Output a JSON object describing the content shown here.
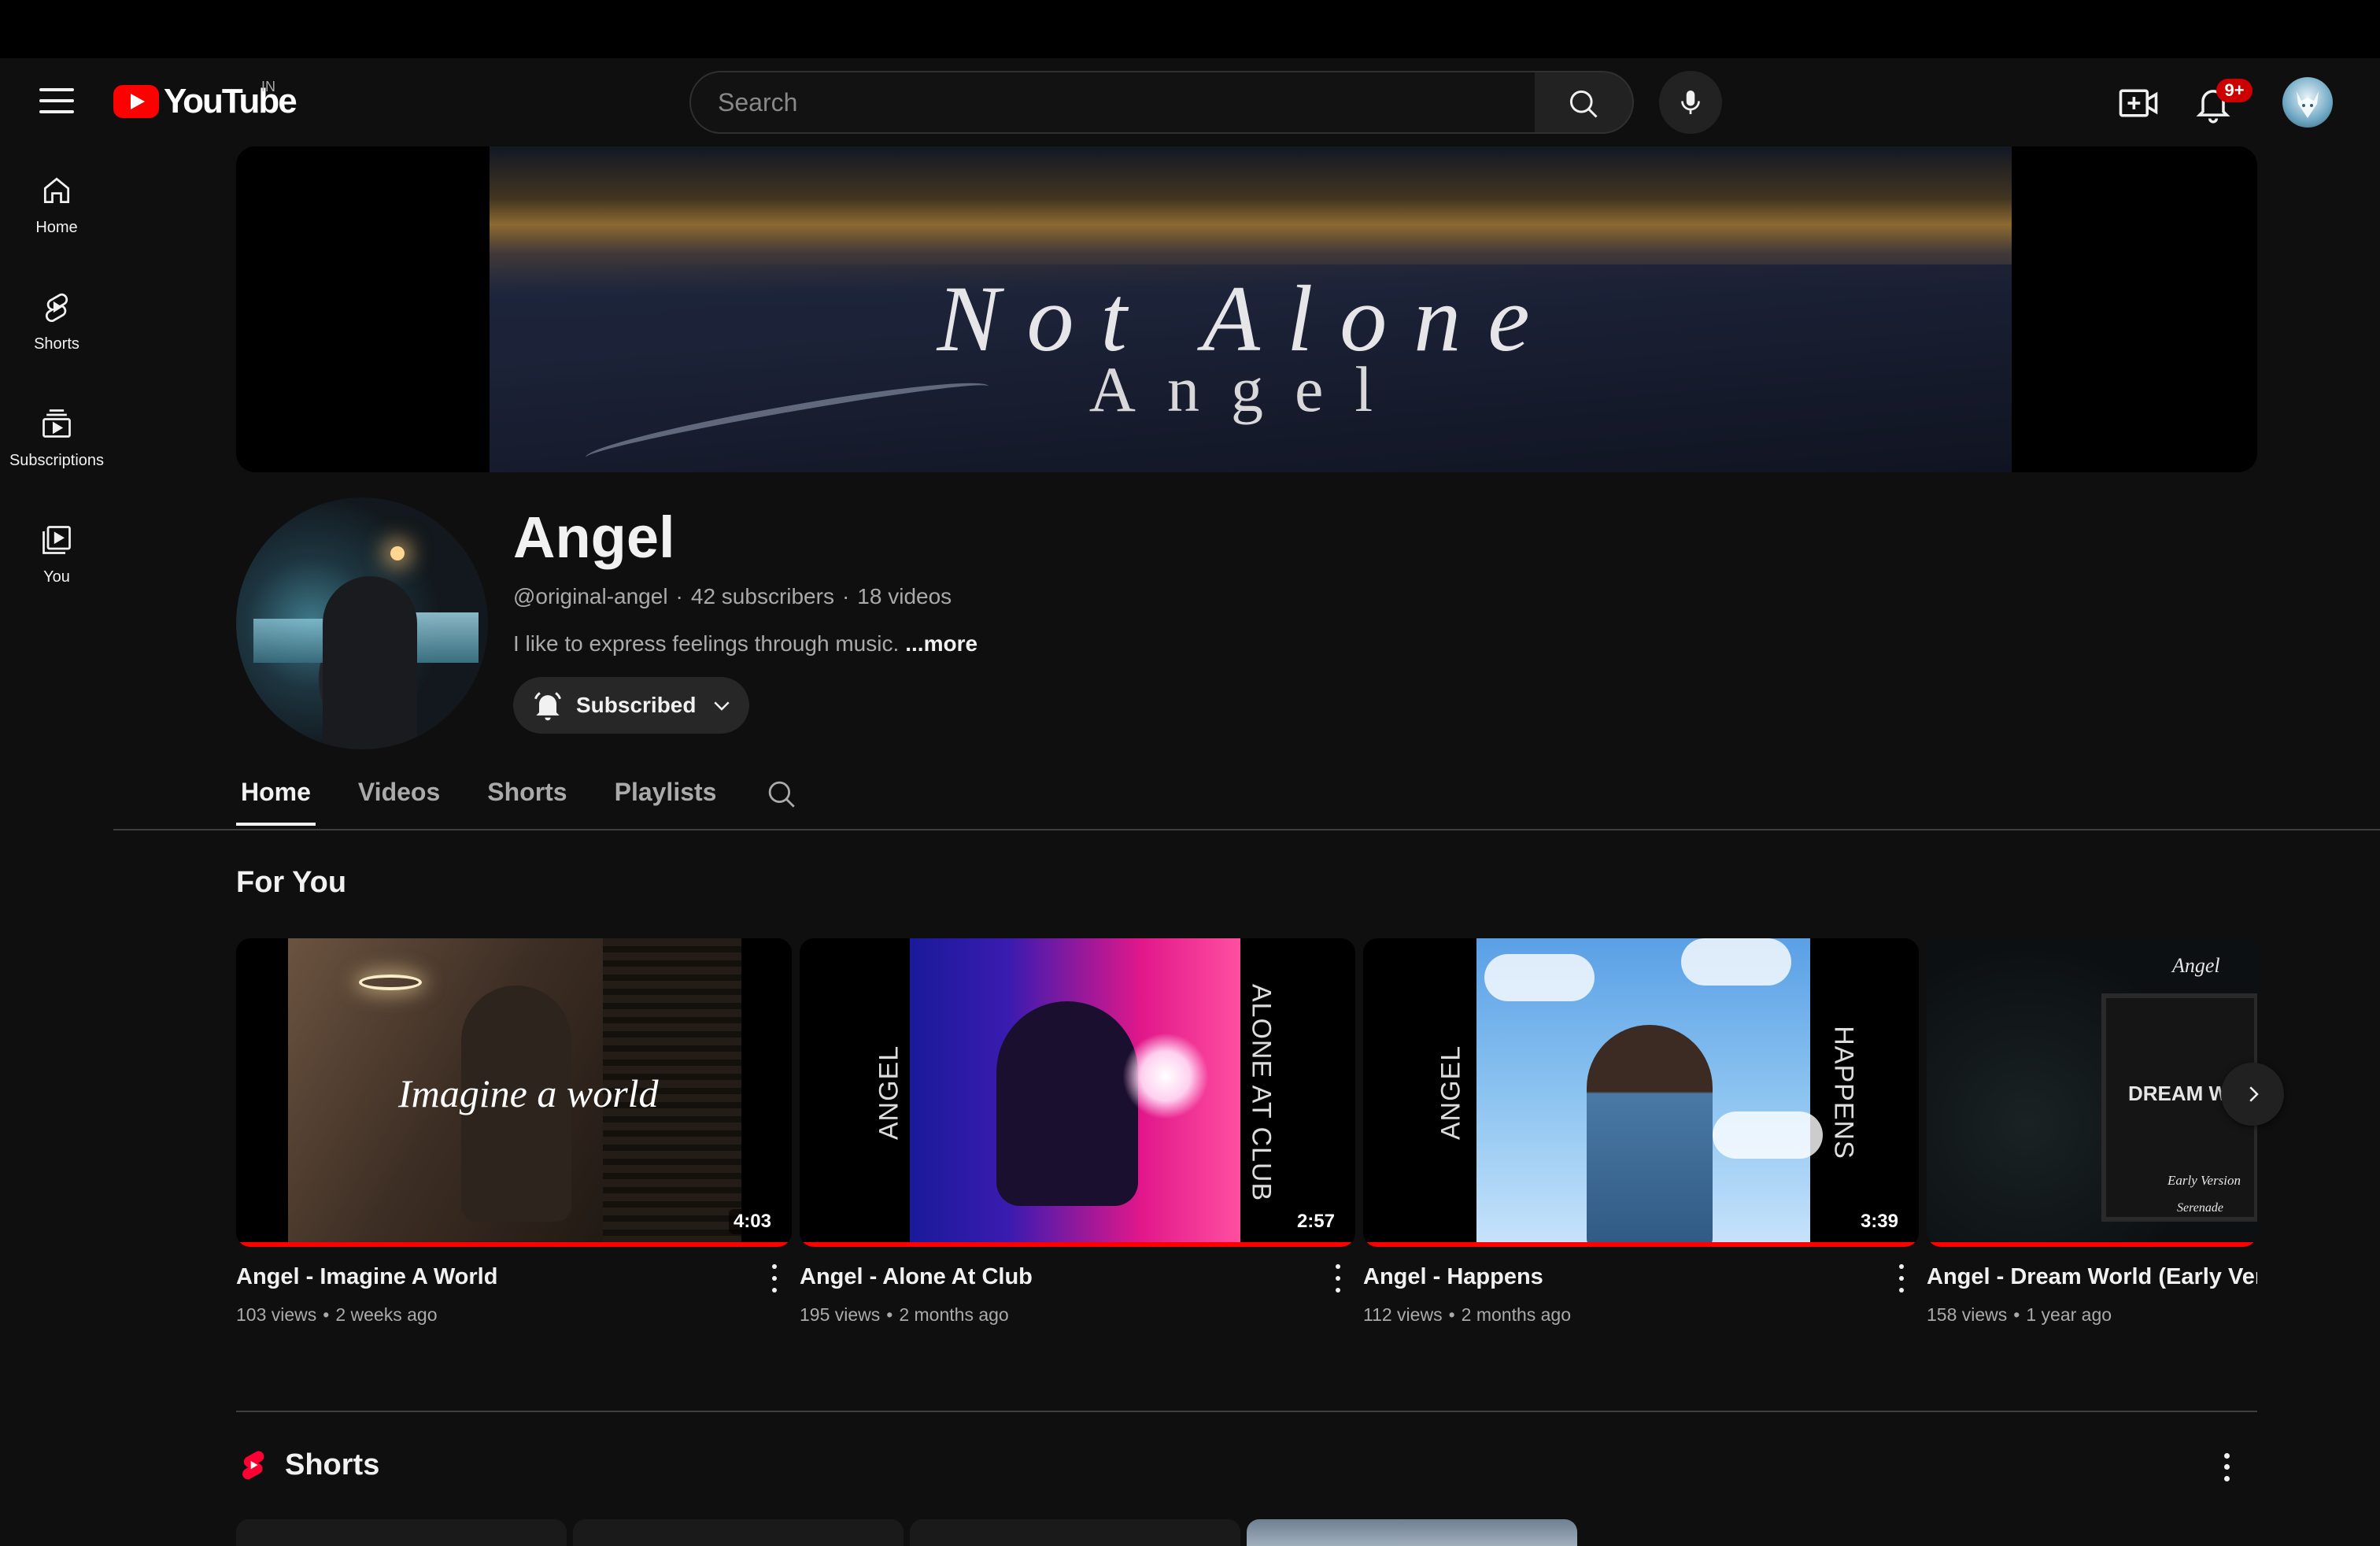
{
  "masthead": {
    "logo_text": "YouTube",
    "region": "IN",
    "search_placeholder": "Search",
    "notification_count": "9+"
  },
  "guide": {
    "items": [
      {
        "label": "Home",
        "icon": "home-icon"
      },
      {
        "label": "Shorts",
        "icon": "shorts-icon"
      },
      {
        "label": "Subscriptions",
        "icon": "subscriptions-icon"
      },
      {
        "label": "You",
        "icon": "you-icon"
      }
    ]
  },
  "banner": {
    "title": "Not Alone",
    "subtitle": "Angel"
  },
  "channel": {
    "name": "Angel",
    "handle": "@original-angel",
    "subscribers": "42 subscribers",
    "videos": "18 videos",
    "description": "I like to express feelings through music.",
    "more_label": "...more",
    "subscribe_label": "Subscribed"
  },
  "tabs": {
    "items": [
      "Home",
      "Videos",
      "Shorts",
      "Playlists"
    ],
    "active": "Home"
  },
  "for_you": {
    "title": "For You",
    "videos": [
      {
        "title": "Angel - Imagine A World",
        "views": "103 views",
        "age": "2 weeks ago",
        "duration": "4:03",
        "thumb_text": "Imagine a world",
        "watched_fraction": 1.0
      },
      {
        "title": "Angel - Alone At Club",
        "views": "195 views",
        "age": "2 months ago",
        "duration": "2:57",
        "thumb_text_left": "ANGEL",
        "thumb_text_right": "ALONE AT CLUB",
        "watched_fraction": 1.0
      },
      {
        "title": "Angel - Happens",
        "views": "112 views",
        "age": "2 months ago",
        "duration": "3:39",
        "thumb_text_left": "ANGEL",
        "thumb_text_right": "HAPPENS",
        "watched_fraction": 1.0
      },
      {
        "title": "Angel - Dream World (Early Versio",
        "views": "158 views",
        "age": "1 year ago",
        "thumb_text_top": "Angel",
        "thumb_text_mid": "DREAM W",
        "thumb_text_low": "Early Version",
        "thumb_text_bottom": "Serenade",
        "watched_fraction": 1.0
      }
    ]
  },
  "shorts": {
    "title": "Shorts"
  },
  "colors": {
    "background": "#0f0f0f",
    "brand_red": "#ff0000",
    "text_primary": "#f1f1f1",
    "text_secondary": "#aaaaaa"
  }
}
